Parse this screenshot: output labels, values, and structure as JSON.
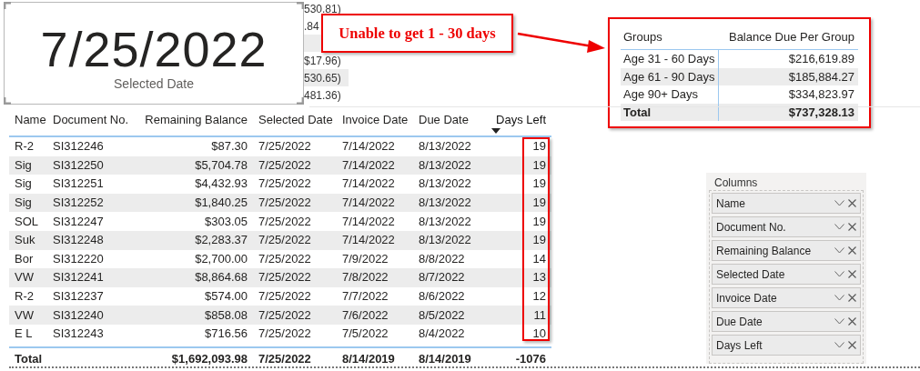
{
  "card": {
    "value": "7/25/2022",
    "label": "Selected Date"
  },
  "background_fragments": [
    {
      "text": "530.81)",
      "shaded": false
    },
    {
      "text": ".84",
      "shaded": false
    },
    {
      "text": "$17.96)",
      "shaded": false
    },
    {
      "text": "530.65)",
      "shaded": true
    },
    {
      "text": "481.36)",
      "shaded": false
    }
  ],
  "callout": {
    "text": "Unable to get 1 - 30 days"
  },
  "groups_table": {
    "columns": [
      "Groups",
      "Balance Due Per Group"
    ],
    "rows": [
      {
        "group": "Age 31 - 60 Days",
        "balance": "$216,619.89"
      },
      {
        "group": "Age 61 - 90 Days",
        "balance": "$185,884.27"
      },
      {
        "group": "Age 90+ Days",
        "balance": "$334,823.97"
      }
    ],
    "total": {
      "label": "Total",
      "value": "$737,328.13"
    }
  },
  "table": {
    "columns": [
      {
        "label": "Name",
        "sorted": false,
        "highlighted": false
      },
      {
        "label": "Document No.",
        "sorted": false,
        "highlighted": false
      },
      {
        "label": "Remaining Balance",
        "sorted": false,
        "highlighted": false
      },
      {
        "label": "Selected Date",
        "sorted": false,
        "highlighted": false
      },
      {
        "label": "Invoice Date",
        "sorted": false,
        "highlighted": false
      },
      {
        "label": "Due Date",
        "sorted": false,
        "highlighted": false
      },
      {
        "label": "Days Left",
        "sorted": true,
        "highlighted": true
      }
    ],
    "rows": [
      [
        "R-2",
        "SI312246",
        "$87.30",
        "7/25/2022",
        "7/14/2022",
        "8/13/2022",
        "19"
      ],
      [
        "Sig",
        "SI312250",
        "$5,704.78",
        "7/25/2022",
        "7/14/2022",
        "8/13/2022",
        "19"
      ],
      [
        "Sig",
        "SI312251",
        "$4,432.93",
        "7/25/2022",
        "7/14/2022",
        "8/13/2022",
        "19"
      ],
      [
        "Sig",
        "SI312252",
        "$1,840.25",
        "7/25/2022",
        "7/14/2022",
        "8/13/2022",
        "19"
      ],
      [
        "SOL",
        "SI312247",
        "$303.05",
        "7/25/2022",
        "7/14/2022",
        "8/13/2022",
        "19"
      ],
      [
        "Suk",
        "SI312248",
        "$2,283.37",
        "7/25/2022",
        "7/14/2022",
        "8/13/2022",
        "19"
      ],
      [
        "Bor",
        "SI312220",
        "$2,700.00",
        "7/25/2022",
        "7/9/2022",
        "8/8/2022",
        "14"
      ],
      [
        "VW",
        "SI312241",
        "$8,864.68",
        "7/25/2022",
        "7/8/2022",
        "8/7/2022",
        "13"
      ],
      [
        "R-2",
        "SI312237",
        "$574.00",
        "7/25/2022",
        "7/7/2022",
        "8/6/2022",
        "12"
      ],
      [
        "VW",
        "SI312240",
        "$858.08",
        "7/25/2022",
        "7/6/2022",
        "8/5/2022",
        "11"
      ],
      [
        "E L",
        "SI312243",
        "$716.56",
        "7/25/2022",
        "7/5/2022",
        "8/4/2022",
        "10"
      ]
    ],
    "total": {
      "label": "Total",
      "values": [
        "$1,692,093.98",
        "7/25/2022",
        "8/14/2019",
        "8/14/2019",
        "-1076"
      ]
    }
  },
  "columns_pane": {
    "title": "Columns",
    "fields": [
      "Name",
      "Document No.",
      "Remaining Balance",
      "Selected Date",
      "Invoice Date",
      "Due Date",
      "Days Left"
    ]
  }
}
